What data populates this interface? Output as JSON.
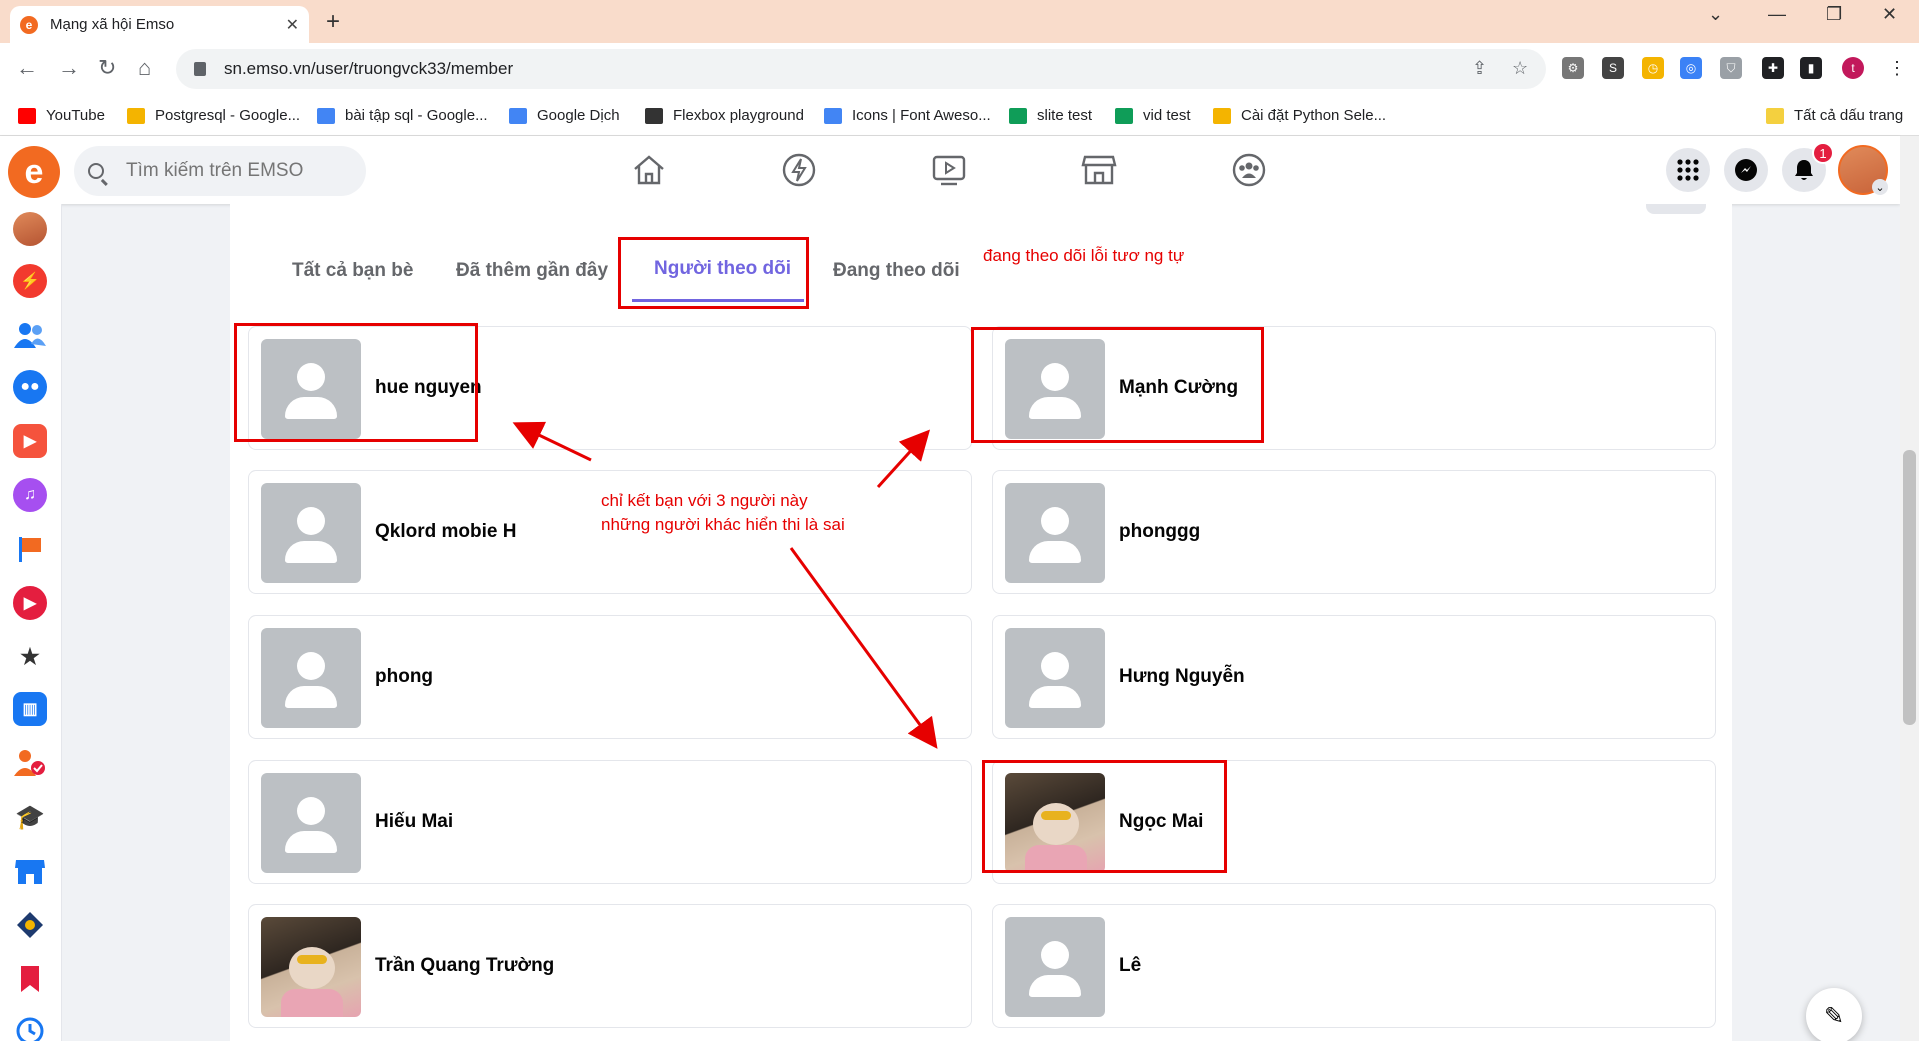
{
  "browser": {
    "tab_title": "Mạng xã hội Emso",
    "url": "sn.emso.vn/user/truongvck33/member",
    "profile_initial": "t",
    "bookmarks": [
      {
        "label": "YouTube",
        "color": "#ff0000"
      },
      {
        "label": "Postgresql - Google...",
        "color": "#f4b400"
      },
      {
        "label": "bài tập sql - Google...",
        "color": "#4285f4"
      },
      {
        "label": "Google Dịch",
        "color": "#4285f4"
      },
      {
        "label": "Flexbox playground",
        "color": "#333333"
      },
      {
        "label": "Icons | Font Aweso...",
        "color": "#4285f4"
      },
      {
        "label": "slite test",
        "color": "#0f9d58"
      },
      {
        "label": "vid test",
        "color": "#0f9d58"
      },
      {
        "label": "Cài đặt Python Sele...",
        "color": "#f4b400"
      }
    ],
    "all_bookmarks": "Tất cả dấu trang"
  },
  "app": {
    "search_placeholder": "Tìm kiếm trên EMSO",
    "notification_count": "1",
    "accent": "#7165e0",
    "brand": "#f26a21"
  },
  "tabs": [
    {
      "label": "Tất cả bạn bè"
    },
    {
      "label": "Đã thêm gần đây"
    },
    {
      "label": "Người theo dõi"
    },
    {
      "label": "Đang theo dõi"
    }
  ],
  "members": [
    {
      "name": "hue nguyen",
      "photo": false
    },
    {
      "name": "Mạnh Cường",
      "photo": false
    },
    {
      "name": "Qklord mobie H",
      "photo": false
    },
    {
      "name": "phonggg",
      "photo": false
    },
    {
      "name": "phong",
      "photo": false
    },
    {
      "name": "Hưng Nguyễn",
      "photo": false
    },
    {
      "name": "Hiếu Mai",
      "photo": false
    },
    {
      "name": "Ngọc Mai",
      "photo": true
    },
    {
      "name": "Trần Quang Trường",
      "photo": true
    },
    {
      "name": "Lê",
      "photo": false
    }
  ],
  "annotations": {
    "note_top": "đang theo dõi lỗi tươ ng tự",
    "note_mid_line1": "chỉ kết bạn với 3 người này",
    "note_mid_line2": "những người khác hiển thi là sai"
  }
}
